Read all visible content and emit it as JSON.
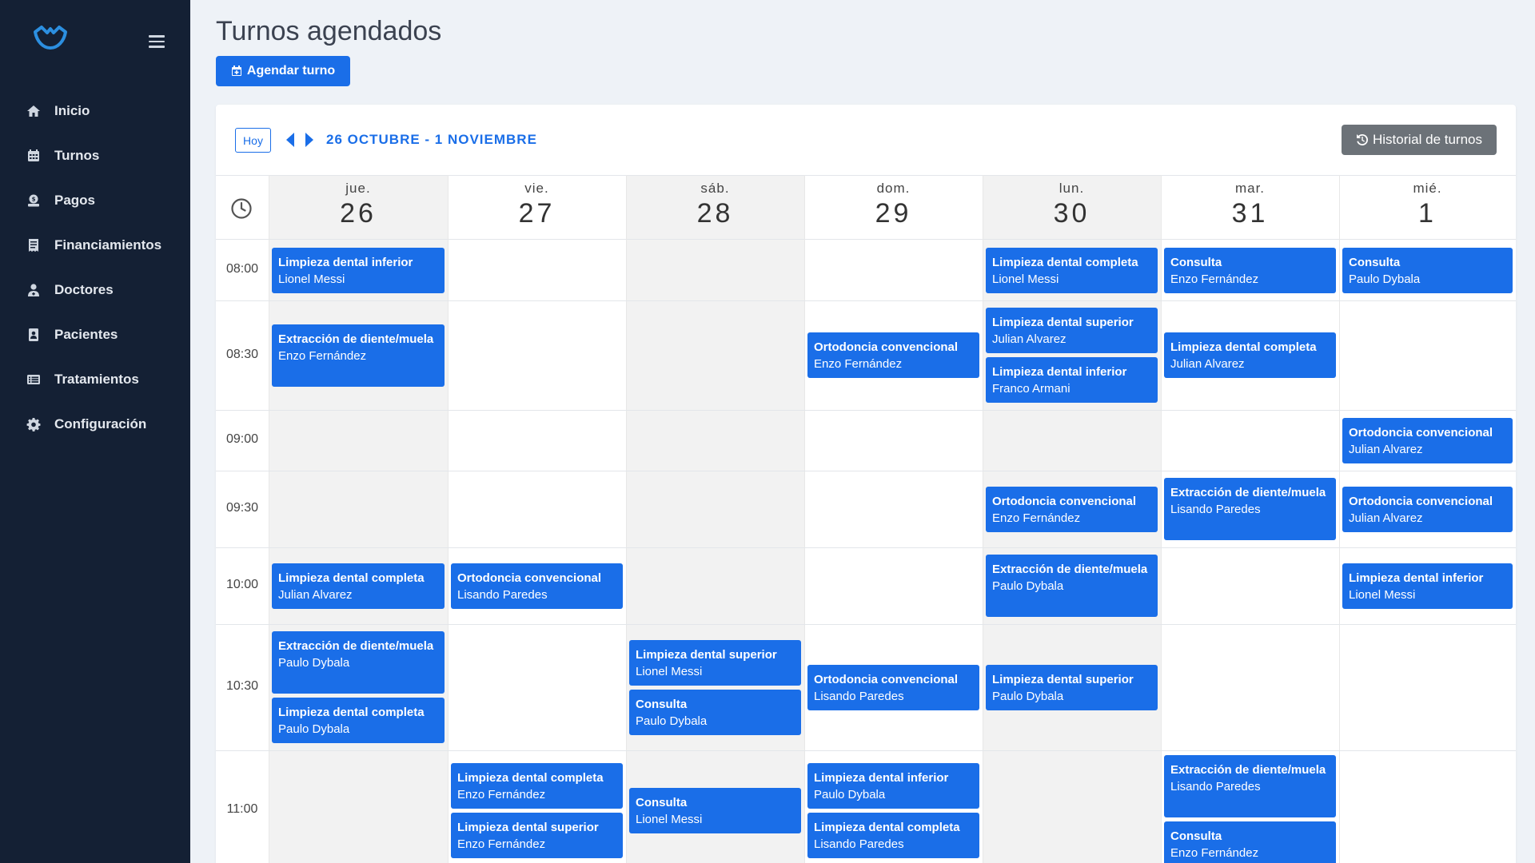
{
  "sidebar": {
    "items": [
      {
        "label": "Inicio",
        "icon": "home-icon"
      },
      {
        "label": "Turnos",
        "icon": "calendar-icon"
      },
      {
        "label": "Pagos",
        "icon": "payment-icon"
      },
      {
        "label": "Financiamientos",
        "icon": "receipt-icon"
      },
      {
        "label": "Doctores",
        "icon": "doctor-icon"
      },
      {
        "label": "Pacientes",
        "icon": "patient-icon"
      },
      {
        "label": "Tratamientos",
        "icon": "list-icon"
      },
      {
        "label": "Configuración",
        "icon": "gear-icon"
      }
    ]
  },
  "header": {
    "title": "Turnos agendados",
    "new_button": "Agendar turno"
  },
  "toolbar": {
    "today": "Hoy",
    "range": "26 OCTUBRE - 1 NOVIEMBRE",
    "history": "Historial de turnos"
  },
  "calendar": {
    "days": [
      {
        "name": "jue.",
        "num": "26"
      },
      {
        "name": "vie.",
        "num": "27"
      },
      {
        "name": "sáb.",
        "num": "28"
      },
      {
        "name": "dom.",
        "num": "29"
      },
      {
        "name": "lun.",
        "num": "30"
      },
      {
        "name": "mar.",
        "num": "31"
      },
      {
        "name": "mié.",
        "num": "1"
      }
    ],
    "times": [
      "08:00",
      "08:30",
      "09:00",
      "09:30",
      "10:00",
      "10:30",
      "11:00"
    ],
    "events": [
      {
        "day": 0,
        "slot": 0,
        "title": "Limpieza dental inferior",
        "patient": "Lionel Messi"
      },
      {
        "day": 4,
        "slot": 0,
        "title": "Limpieza dental completa",
        "patient": "Lionel Messi"
      },
      {
        "day": 5,
        "slot": 0,
        "title": "Consulta",
        "patient": "Enzo Fernández"
      },
      {
        "day": 6,
        "slot": 0,
        "title": "Consulta",
        "patient": "Paulo Dybala"
      },
      {
        "day": 0,
        "slot": 1,
        "title": "Extracción de diente/muela",
        "patient": "Enzo Fernández"
      },
      {
        "day": 3,
        "slot": 1,
        "title": "Ortodoncia convencional",
        "patient": "Enzo Fernández"
      },
      {
        "day": 4,
        "slot": 1,
        "title": "Limpieza dental superior",
        "patient": "Julian Alvarez"
      },
      {
        "day": 4,
        "slot": 1,
        "title": "Limpieza dental inferior",
        "patient": "Franco Armani"
      },
      {
        "day": 5,
        "slot": 1,
        "title": "Limpieza dental completa",
        "patient": "Julian Alvarez"
      },
      {
        "day": 6,
        "slot": 2,
        "title": "Ortodoncia convencional",
        "patient": "Julian Alvarez"
      },
      {
        "day": 4,
        "slot": 3,
        "title": "Ortodoncia convencional",
        "patient": "Enzo Fernández"
      },
      {
        "day": 5,
        "slot": 3,
        "title": "Extracción de diente/muela",
        "patient": "Lisando Paredes"
      },
      {
        "day": 6,
        "slot": 3,
        "title": "Ortodoncia convencional",
        "patient": "Julian Alvarez"
      },
      {
        "day": 0,
        "slot": 4,
        "title": "Limpieza dental completa",
        "patient": "Julian Alvarez"
      },
      {
        "day": 1,
        "slot": 4,
        "title": "Ortodoncia convencional",
        "patient": "Lisando Paredes"
      },
      {
        "day": 4,
        "slot": 4,
        "title": "Extracción de diente/muela",
        "patient": "Paulo Dybala"
      },
      {
        "day": 6,
        "slot": 4,
        "title": "Limpieza dental inferior",
        "patient": "Lionel Messi"
      },
      {
        "day": 0,
        "slot": 5,
        "title": "Extracción de diente/muela",
        "patient": "Paulo Dybala"
      },
      {
        "day": 0,
        "slot": 5,
        "title": "Limpieza dental completa",
        "patient": "Paulo Dybala"
      },
      {
        "day": 2,
        "slot": 5,
        "title": "Limpieza dental superior",
        "patient": "Lionel Messi"
      },
      {
        "day": 2,
        "slot": 5,
        "title": "Consulta",
        "patient": "Paulo Dybala"
      },
      {
        "day": 3,
        "slot": 5,
        "title": "Ortodoncia convencional",
        "patient": "Lisando Paredes"
      },
      {
        "day": 4,
        "slot": 5,
        "title": "Limpieza dental superior",
        "patient": "Paulo Dybala"
      },
      {
        "day": 1,
        "slot": 6,
        "title": "Limpieza dental completa",
        "patient": "Enzo Fernández"
      },
      {
        "day": 1,
        "slot": 6,
        "title": "Limpieza dental superior",
        "patient": "Enzo Fernández"
      },
      {
        "day": 2,
        "slot": 6,
        "title": "Consulta",
        "patient": "Lionel Messi"
      },
      {
        "day": 3,
        "slot": 6,
        "title": "Limpieza dental inferior",
        "patient": "Paulo Dybala"
      },
      {
        "day": 3,
        "slot": 6,
        "title": "Limpieza dental completa",
        "patient": "Lisando Paredes"
      },
      {
        "day": 5,
        "slot": 6,
        "title": "Extracción de diente/muela",
        "patient": "Lisando Paredes"
      },
      {
        "day": 5,
        "slot": 6,
        "title": "Consulta",
        "patient": "Enzo Fernández"
      }
    ]
  },
  "colors": {
    "sidebar_bg": "#142034",
    "accent": "#1a6ee8",
    "history_button": "#6c7278"
  }
}
